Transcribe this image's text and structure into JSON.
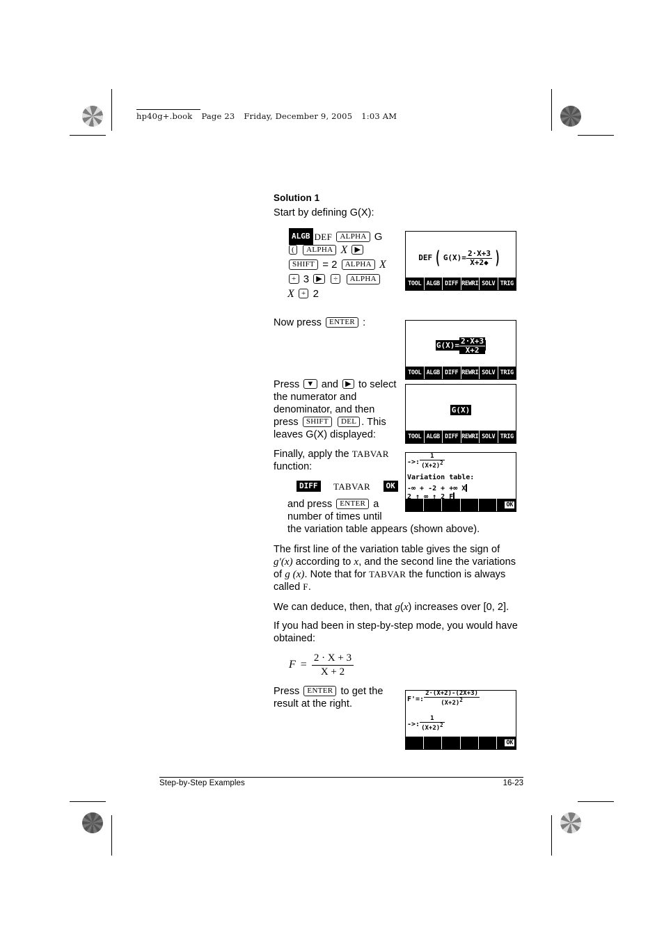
{
  "slug": {
    "file": "hp40g+.book",
    "page": "Page 23",
    "day": "Friday, December 9, 2005",
    "time": "1:03 AM"
  },
  "content": {
    "heading": "Solution 1",
    "intro": "Start by defining G(X):",
    "now_press_pre": "Now press",
    "now_press_key": "ENTER",
    "now_press_post": ":",
    "select_p1": "Press",
    "select_key_down": "▼",
    "select_and": "and",
    "select_key_right": "▶",
    "select_p2": "to select",
    "select_l2": "the numerator and",
    "select_l3": "denominator, and then",
    "select_p3": "press",
    "select_key_shift": "SHIFT",
    "select_key_del": "DEL",
    "select_p4": ". This",
    "select_l5": "leaves G(X) displayed:",
    "finally_pre": "Finally, apply the",
    "finally_fn": "TABVAR",
    "finally_post": "function:",
    "diff_key": "DIFF",
    "tabvar_label": "TABVAR",
    "ok_key": "OK",
    "and_press": "and press",
    "enter_key": "ENTER",
    "a_word": "a",
    "until_l1": "number of times until",
    "until_l2": "the variation table appears (shown above).",
    "para_firstline": [
      "The first line of the variation table gives the sign of",
      "g′(x) according to x, and the second line the variations",
      "of g (x). Note that for TABVAR the function is always",
      "called F."
    ],
    "para_deduce": "We can deduce, then, that g(x) increases over [0, 2].",
    "para_step_l1": "If you had been in step-by-step mode, you would have",
    "para_step_l2": "obtained:",
    "para_press_l1_pre": "Press",
    "para_press_key": "ENTER",
    "para_press_l1_post": "to get the",
    "para_press_l2": "result at the right."
  },
  "keystrokes": {
    "rows": [
      [
        {
          "t": "invkey",
          "v": "ALGB"
        },
        {
          "t": "mono",
          "v": "DEF"
        },
        {
          "t": "key",
          "v": "ALPHA"
        },
        {
          "t": "plain",
          "v": "G"
        }
      ],
      [
        {
          "t": "key",
          "v": "("
        },
        {
          "t": "key",
          "v": "ALPHA"
        },
        {
          "t": "var",
          "v": "X"
        },
        {
          "t": "key",
          "v": "▶"
        }
      ],
      [
        {
          "t": "key",
          "v": "SHIFT"
        },
        {
          "t": "plain",
          "v": "="
        },
        {
          "t": "num",
          "v": "2"
        },
        {
          "t": "key",
          "v": "ALPHA"
        },
        {
          "t": "var",
          "v": "X"
        }
      ],
      [
        {
          "t": "key",
          "v": "+"
        },
        {
          "t": "num",
          "v": "3"
        },
        {
          "t": "key",
          "v": "▶"
        },
        {
          "t": "key",
          "v": "÷"
        },
        {
          "t": "key",
          "v": "ALPHA"
        }
      ],
      [
        {
          "t": "var",
          "v": "X"
        },
        {
          "t": "key",
          "v": "+"
        },
        {
          "t": "num",
          "v": "2"
        }
      ]
    ]
  },
  "display_math": {
    "lhs": "F",
    "eq": "=",
    "numerator": "2 · X + 3",
    "denominator": "X + 2"
  },
  "screens": {
    "menu_main": [
      "TOOL",
      "ALGB",
      "DIFF",
      "REWRI",
      "SOLV",
      "TRIG"
    ],
    "menu_ok": [
      "",
      "",
      "",
      "",
      "",
      "OK"
    ],
    "screen1": {
      "prefix": "DEF",
      "inner_lhs": "G(X)=",
      "numerator": "2·X+3",
      "denominator": "X+2◆"
    },
    "screen2": {
      "lhs": "G(X)=",
      "numerator": "2·X+3",
      "denominator": "X+2"
    },
    "screen3": {
      "text": "G(X)"
    },
    "screen4": {
      "line1_prefix": "->:",
      "line1_numerator": "1",
      "line1_denominator": "(X+2)",
      "line1_exp": "2",
      "title": "Variation table:",
      "row1": "-∞ + -2 + +∞ X",
      "row2": "2 ↑ ∞ ↑ 2 F"
    },
    "screen5": {
      "line1_lhs": "F'=:",
      "line1_numerator": "2·(X+2)-(2X+3)",
      "line1_denominator": "(X+2)",
      "line1_den_exp": "2",
      "line2_lhs": "->:",
      "line2_numerator": "1",
      "line2_denominator": "(X+2)",
      "line2_den_exp": "2"
    }
  },
  "footer": {
    "left": "Step-by-Step Examples",
    "right": "16-23"
  }
}
